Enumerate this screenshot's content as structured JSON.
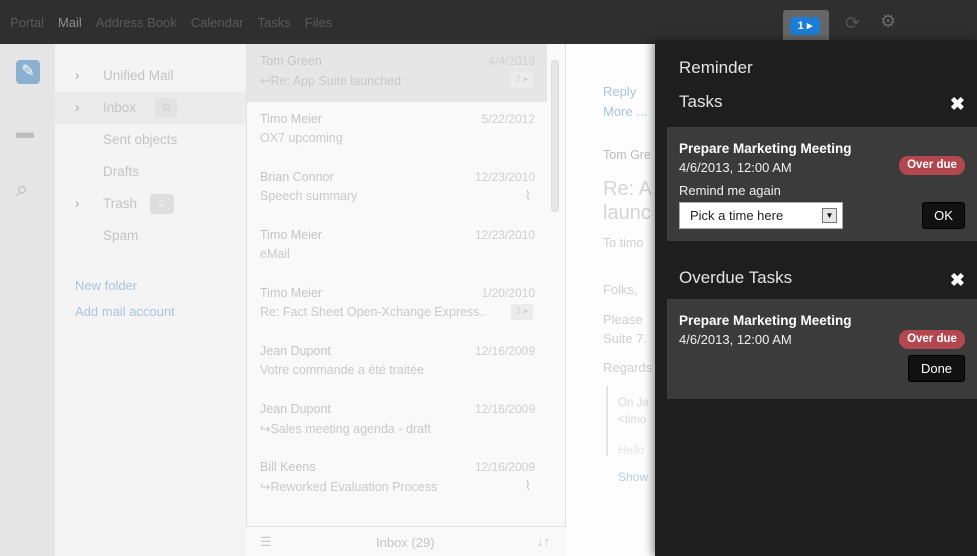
{
  "topnav": [
    "Portal",
    "Mail",
    "Address Book",
    "Calendar",
    "Tasks",
    "Files"
  ],
  "notification_count": "1 ▸",
  "folders": [
    {
      "label": "Unified Mail",
      "chevron": "›"
    },
    {
      "label": "Inbox",
      "chevron": "›",
      "gear": "⚙"
    },
    {
      "label": "Sent objects"
    },
    {
      "label": "Drafts"
    },
    {
      "label": "Trash",
      "chevron": "›",
      "count": "2"
    },
    {
      "label": "Spam"
    }
  ],
  "folder_links": {
    "new_folder": "New folder",
    "add_account": "Add mail account"
  },
  "mails": [
    {
      "from": "Tom Green",
      "date": "4/4/2013",
      "subject": "↩Re: App Suite launched",
      "thread": "2 ▸"
    },
    {
      "from": "Timo Meier",
      "date": "5/22/2012",
      "subject": "OX7 upcoming"
    },
    {
      "from": "Brian Connor",
      "date": "12/23/2010",
      "subject": "Speech summary",
      "attachment": true
    },
    {
      "from": "Timo Meier",
      "date": "12/23/2010",
      "subject": "eMail"
    },
    {
      "from": "Timo Meier",
      "date": "1/20/2010",
      "subject": "Re: Fact Sheet Open-Xchange Express...",
      "thread": "3 ▸"
    },
    {
      "from": "Jean Dupont",
      "date": "12/16/2009",
      "subject": "Votre commande a été traitée"
    },
    {
      "from": "Jean Dupont",
      "date": "12/16/2009",
      "subject": "↪Sales meeting agenda - draft"
    },
    {
      "from": "Bill Keens",
      "date": "12/16/2009",
      "subject": "↪Reworked Evaluation Process",
      "attachment": true
    }
  ],
  "list_footer": {
    "folder": "Inbox (29)",
    "lines_icon": "☰",
    "sort_icon": "↓↑"
  },
  "preview": {
    "reply": "Reply",
    "more": "More ...",
    "from": "Tom Gre",
    "subject1": "Re: A",
    "subject2": "launc",
    "to": "To  timo",
    "greet": "Folks,",
    "body1": "Please",
    "body2": "Suite 7.",
    "regards": "Regards",
    "quote1": "On Ja",
    "quote2": "<timo",
    "quote3": "Hello",
    "show": "Show"
  },
  "reminder": {
    "title": "Reminder",
    "tasks_header": "Tasks",
    "task": {
      "title": "Prepare Marketing Meeting",
      "when": "4/6/2013, 12:00 AM",
      "status": "Over due"
    },
    "remind_label": "Remind me again",
    "select_placeholder": "Pick a time here",
    "ok": "OK",
    "overdue_header": "Overdue Tasks",
    "overdue_task": {
      "title": "Prepare Marketing Meeting",
      "when": "4/6/2013, 12:00 AM",
      "status": "Over due"
    },
    "done": "Done"
  },
  "colors": {
    "accent": "#1c7dd6",
    "overdue": "#b2474f",
    "panel": "#1e1e1e",
    "card": "#3b3b3b"
  }
}
